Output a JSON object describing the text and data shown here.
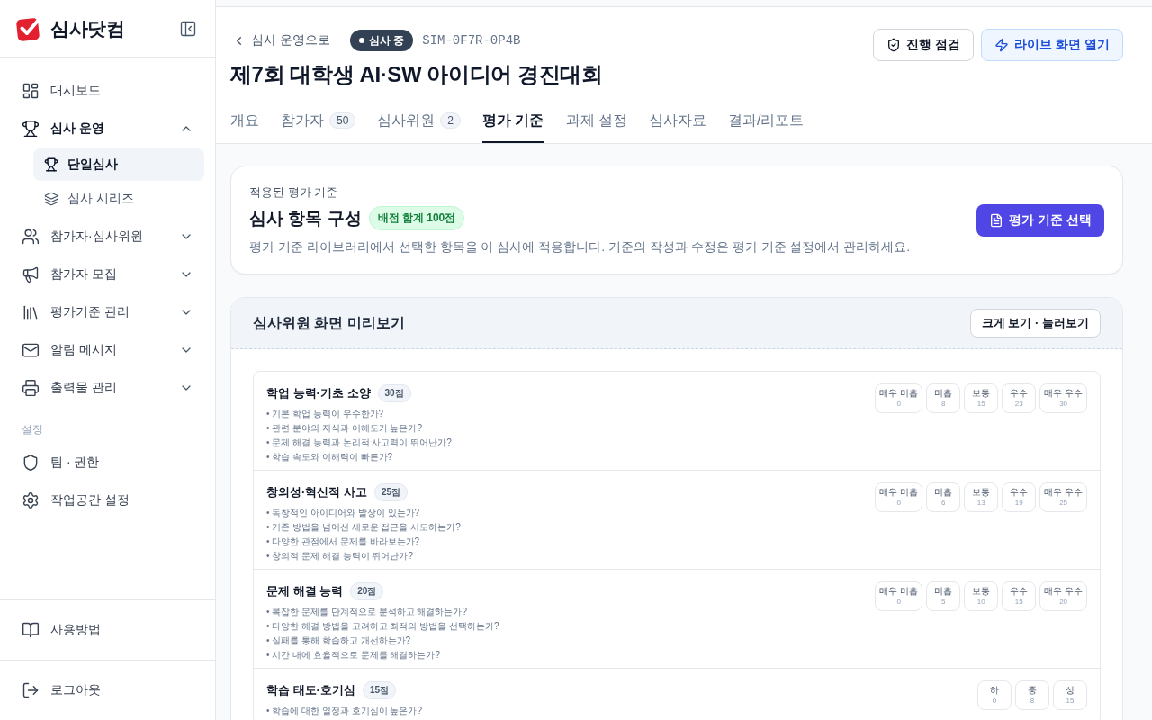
{
  "sidebar": {
    "brand": "심사닷컴",
    "nav": [
      {
        "label": "대시보드",
        "selected": false
      },
      {
        "label": "심사 운영",
        "selected": false,
        "expanded": true,
        "children": [
          {
            "label": "단일심사",
            "selected": true
          },
          {
            "label": "심사 시리즈",
            "selected": false
          }
        ]
      },
      {
        "label": "참가자·심사위원",
        "selected": false,
        "expanded": false
      },
      {
        "label": "참가자 모집",
        "selected": false,
        "expanded": false
      },
      {
        "label": "평가기준 관리",
        "selected": false,
        "expanded": false
      },
      {
        "label": "알림 메시지",
        "selected": false,
        "expanded": false
      },
      {
        "label": "출력물 관리",
        "selected": false,
        "expanded": false
      }
    ],
    "settings_label": "설정",
    "settings": [
      {
        "label": "팀 · 권한",
        "selected": false
      },
      {
        "label": "작업공간 설정",
        "selected": false
      }
    ],
    "footer": [
      "사용방법",
      "로그아웃"
    ]
  },
  "header": {
    "back_link": "심사 운영으로",
    "status": "심사 중",
    "code": "SIM-0F7R-0P4B",
    "title": "제7회 대학생 AI·SW 아이디어 경진대회",
    "actions": [
      {
        "label": "진행 점검",
        "kind": "outline"
      },
      {
        "label": "라이브 화면 열기",
        "kind": "accent"
      }
    ],
    "tabs": [
      {
        "label": "개요",
        "selected": false
      },
      {
        "label": "참가자",
        "count": "50",
        "selected": false
      },
      {
        "label": "심사위원",
        "count": "2",
        "selected": false
      },
      {
        "label": "평가 기준",
        "selected": true
      },
      {
        "label": "과제 설정",
        "selected": false
      },
      {
        "label": "심사자료",
        "selected": false
      },
      {
        "label": "결과/리포트",
        "selected": false
      }
    ]
  },
  "criteria": {
    "eyebrow": "적용된 평가 기준",
    "title": "심사 항목 구성",
    "total_badge": "배점 합계 100점",
    "description": "평가 기준 라이브러리에서 선택한 항목을 이 심사에 적용합니다. 기준의 작성과 수정은 평가 기준 설정에서 관리하세요.",
    "button": "평가 기준 선택"
  },
  "preview": {
    "title": "심사위원 화면 미리보기",
    "button": "크게 보기 · 눌러보기",
    "items": [
      {
        "title": "학업 능력·기초 소양",
        "points": "30점",
        "questions": [
          "• 기본 학업 능력이 우수한가?",
          "• 관련 분야의 지식과 이해도가 높은가?",
          "• 문제 해결 능력과 논리적 사고력이 뛰어난가?",
          "• 학습 속도와 이해력이 빠른가?"
        ],
        "scale": [
          {
            "label": "매우 미흡",
            "score": "0"
          },
          {
            "label": "미흡",
            "score": "8"
          },
          {
            "label": "보통",
            "score": "15"
          },
          {
            "label": "우수",
            "score": "23"
          },
          {
            "label": "매우 우수",
            "score": "30"
          }
        ]
      },
      {
        "title": "창의성·혁신적 사고",
        "points": "25점",
        "questions": [
          "• 독창적인 아이디어와 발상이 있는가?",
          "• 기존 방법을 넘어선 새로운 접근을 시도하는가?",
          "• 다양한 관점에서 문제를 바라보는가?",
          "• 창의적 문제 해결 능력이 뛰어난가?"
        ],
        "scale": [
          {
            "label": "매우 미흡",
            "score": "0"
          },
          {
            "label": "미흡",
            "score": "6"
          },
          {
            "label": "보통",
            "score": "13"
          },
          {
            "label": "우수",
            "score": "19"
          },
          {
            "label": "매우 우수",
            "score": "25"
          }
        ]
      },
      {
        "title": "문제 해결 능력",
        "points": "20점",
        "questions": [
          "• 복잡한 문제를 단계적으로 분석하고 해결하는가?",
          "• 다양한 해결 방법을 고려하고 최적의 방법을 선택하는가?",
          "• 실패를 통해 학습하고 개선하는가?",
          "• 시간 내에 효율적으로 문제를 해결하는가?"
        ],
        "scale": [
          {
            "label": "매우 미흡",
            "score": "0"
          },
          {
            "label": "미흡",
            "score": "5"
          },
          {
            "label": "보통",
            "score": "10"
          },
          {
            "label": "우수",
            "score": "15"
          },
          {
            "label": "매우 우수",
            "score": "20"
          }
        ]
      },
      {
        "title": "학습 태도·호기심",
        "points": "15점",
        "questions": [
          "• 학습에 대한 열정과 호기심이 높은가?"
        ],
        "scale": [
          {
            "label": "하",
            "score": "0"
          },
          {
            "label": "중",
            "score": "8"
          },
          {
            "label": "상",
            "score": "15"
          }
        ]
      }
    ]
  }
}
